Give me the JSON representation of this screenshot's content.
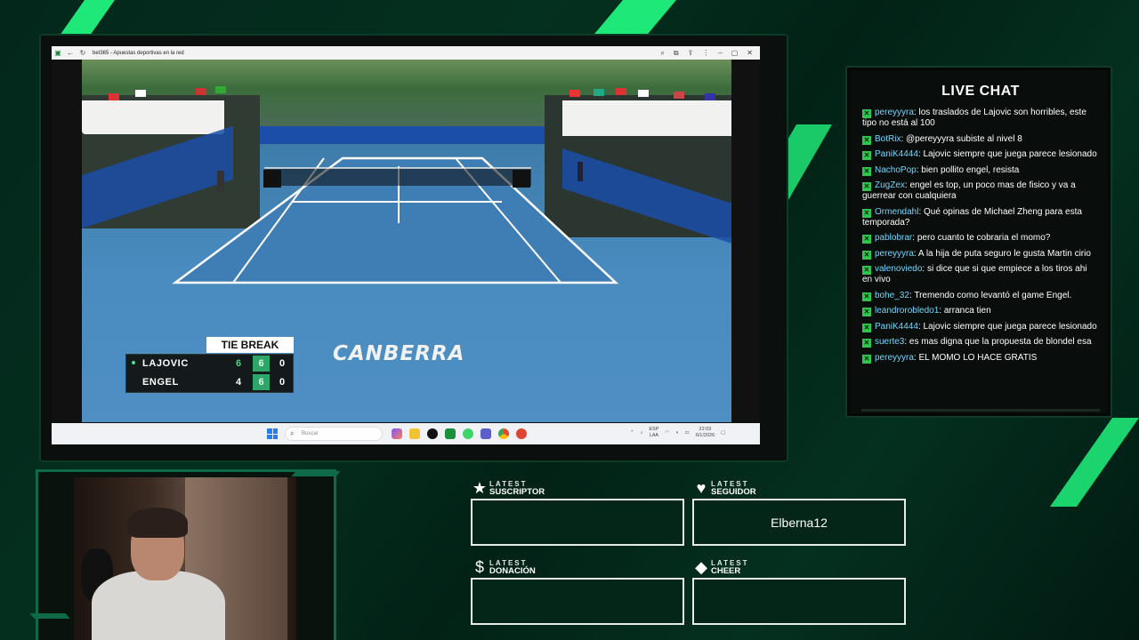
{
  "browser": {
    "tab_title": "bet365 - Apuestas deportivas en la red"
  },
  "scoreboard": {
    "tiebreak_label": "TIE BREAK",
    "players": [
      {
        "name": "LAJOVIC",
        "set1": "6",
        "set2": "6",
        "points": "0",
        "serving": true
      },
      {
        "name": "ENGEL",
        "set1": "4",
        "set2": "6",
        "points": "0",
        "serving": false
      }
    ],
    "court_logo": "CANBERRA"
  },
  "taskbar": {
    "search_placeholder": "Buscar",
    "lang_top": "ESP",
    "lang_bottom": "LAA",
    "time": "22:03",
    "date": "6/1/2026"
  },
  "chat": {
    "title": "LIVE CHAT",
    "messages": [
      {
        "user": "pereyyyra",
        "text": "los traslados de Lajovic son horribles, este tipo no está al 100"
      },
      {
        "user": "BotRix",
        "text": "@pereyyyra subiste al nivel 8"
      },
      {
        "user": "PaniK4444",
        "text": "Lajovic siempre que juega parece lesionado"
      },
      {
        "user": "NachoPop",
        "text": "bien pollito engel, resista"
      },
      {
        "user": "ZugZex",
        "text": "engel es top, un poco mas de fisico y va a guerrear con cualquiera"
      },
      {
        "user": "Ormendahl",
        "text": "Qué opinas de Michael Zheng para esta temporada?"
      },
      {
        "user": "pablobrar",
        "text": "pero cuanto te cobraria el momo?"
      },
      {
        "user": "pereyyyra",
        "text": "A la hija de puta seguro le gusta Martin cirio"
      },
      {
        "user": "valenoviedo",
        "text": "si dice que si que empiece a los tiros ahi en vivo"
      },
      {
        "user": "bohe_32",
        "text": "Tremendo como levantó el game Engel."
      },
      {
        "user": "leandrorobledo1",
        "text": "arranca tien"
      },
      {
        "user": "PaniK4444",
        "text": "Lajovic siempre que juega parece lesionado"
      },
      {
        "user": "suerte3",
        "text": "es mas digna que la propuesta de blondel esa"
      },
      {
        "user": "pereyyyra",
        "text": "EL MOMO LO HACE GRATIS"
      }
    ]
  },
  "widgets": {
    "suscriptor": {
      "small": "LATEST",
      "big": "SUSCRIPTOR",
      "value": ""
    },
    "seguidor": {
      "small": "LATEST",
      "big": "SEGUIDOR",
      "value": "Elberna12"
    },
    "donacion": {
      "small": "LATEST",
      "big": "DONACIÓN",
      "value": ""
    },
    "cheer": {
      "small": "LATEST",
      "big": "CHEER",
      "value": ""
    }
  }
}
